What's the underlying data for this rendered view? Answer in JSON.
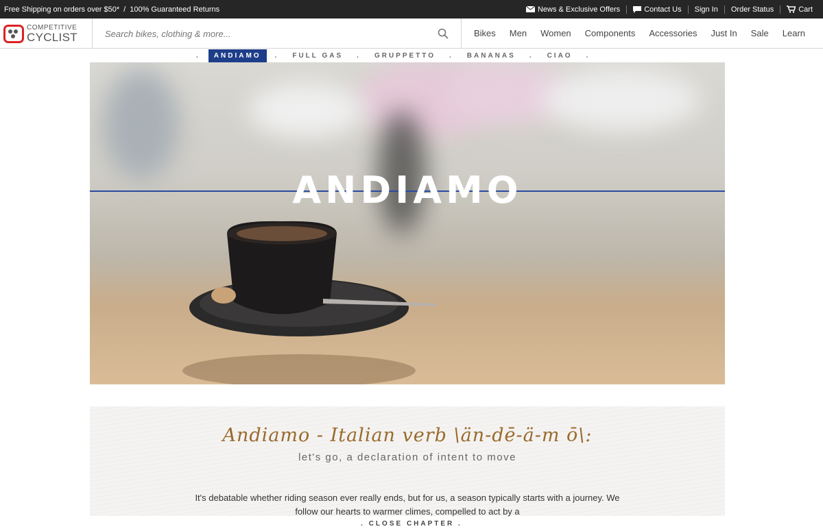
{
  "topbar": {
    "promo": "Free Shipping on orders over $50*",
    "separator": "/",
    "returns": "100% Guaranteed Returns",
    "links": [
      {
        "label": "News & Exclusive Offers",
        "icon": "envelope-icon"
      },
      {
        "label": "Contact Us",
        "icon": "chat-bubble-icon"
      },
      {
        "label": "Sign In",
        "icon": ""
      },
      {
        "label": "Order Status",
        "icon": ""
      },
      {
        "label": "Cart",
        "icon": "cart-icon"
      }
    ]
  },
  "logo": {
    "line1": "COMPETITIVE",
    "line2": "CYCLIST"
  },
  "search": {
    "placeholder": "Search bikes, clothing & more..."
  },
  "nav": [
    "Bikes",
    "Men",
    "Women",
    "Components",
    "Accessories",
    "Just In",
    "Sale",
    "Learn"
  ],
  "chapters": {
    "items": [
      "ANDIAMO",
      "FULL GAS",
      "GRUPPETTO",
      "BANANAS",
      "CIAO"
    ],
    "active": "ANDIAMO",
    "dot": "."
  },
  "hero": {
    "title": "ANDIAMO"
  },
  "intro": {
    "headline": "Andiamo - Italian verb \\än-dē-ä-m ō\\:",
    "subheadline": "let's go, a declaration of intent to move",
    "body": "It's debatable whether riding season ever really ends, but for us, a season typically starts with a journey. We follow our hearts to warmer climes, compelled to act by a"
  },
  "close_chapter": ". CLOSE CHAPTER .",
  "colors": {
    "accent": "#1f3e8a",
    "brand_red": "#dd2222",
    "headline_brown": "#9a6a2c"
  }
}
